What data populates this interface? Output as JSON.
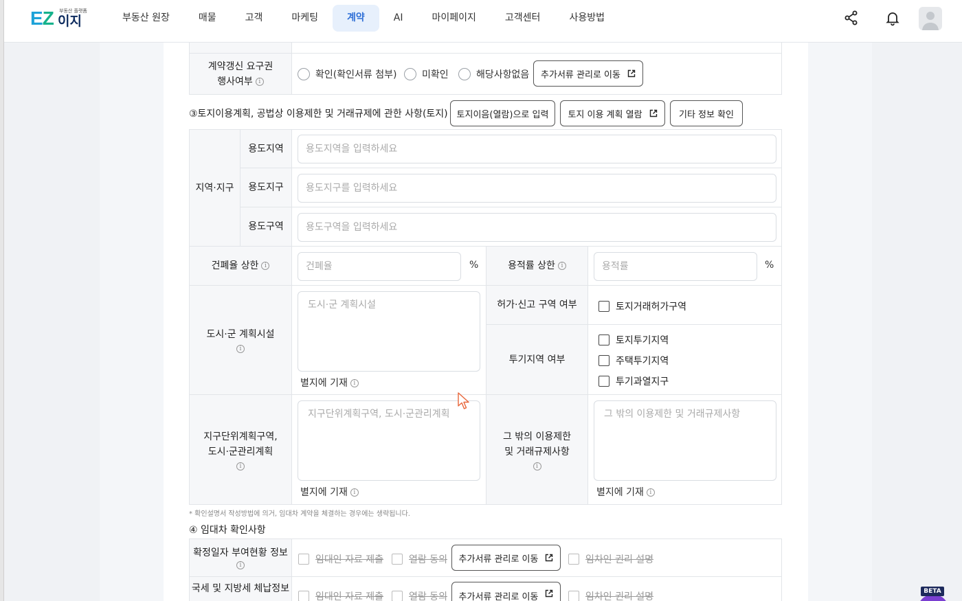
{
  "header": {
    "logo_text": "EZ",
    "logo_korean": "이지",
    "logo_tagline": "부동산 플랫폼",
    "nav": [
      {
        "label": "부동산 원장",
        "active": false
      },
      {
        "label": "매물",
        "active": false
      },
      {
        "label": "고객",
        "active": false
      },
      {
        "label": "마케팅",
        "active": false
      },
      {
        "label": "계약",
        "active": true
      },
      {
        "label": "AI",
        "active": false
      },
      {
        "label": "마이페이지",
        "active": false
      },
      {
        "label": "고객센터",
        "active": false
      },
      {
        "label": "사용방법",
        "active": false
      }
    ],
    "icons": [
      "share-icon",
      "bell-icon",
      "avatar"
    ],
    "accent_color": "#2f6fd6"
  },
  "renewal": {
    "label_line1": "계약갱신 요구권",
    "label_line2": "행사여부",
    "options": [
      "확인(확인서류 첨부)",
      "미확인",
      "해당사항없음"
    ],
    "button": "추가서류 관리로 이동"
  },
  "section3": {
    "title": "③토지이용계획, 공법상 이용제한 및 거래규제에 관한 사항(토지)",
    "buttons": [
      "토지이음(열람)으로 입력",
      "토지 이용 계획 열람",
      "기타 정보 확인"
    ],
    "zone_group_label": "지역·지구",
    "zones": [
      {
        "label": "용도지역",
        "placeholder": "용도지역을 입력하세요"
      },
      {
        "label": "용도지구",
        "placeholder": "용도지구를 입력하세요"
      },
      {
        "label": "용도구역",
        "placeholder": "용도구역을 입력하세요"
      }
    ],
    "coverage": {
      "label": "건폐율 상한",
      "placeholder": "건폐율",
      "unit": "%"
    },
    "far": {
      "label": "용적률 상한",
      "placeholder": "용적률",
      "unit": "%"
    },
    "city_plan": {
      "label": "도시·군 계획시설",
      "placeholder": "도시·군 계획시설",
      "attach": "별지에 기재"
    },
    "permit": {
      "label": "허가·신고 구역 여부",
      "option": "토지거래허가구역"
    },
    "speculation": {
      "label": "투기지역 여부",
      "options": [
        "토지투기지역",
        "주택투기지역",
        "투기과열지구"
      ]
    },
    "district_plan": {
      "label_line1": "지구단위계획구역,",
      "label_line2": "도시·군관리계획",
      "placeholder": "지구단위계획구역, 도시·군관리계획",
      "attach": "별지에 기재"
    },
    "other": {
      "label_line1": "그 밖의 이용제한",
      "label_line2": "및 거래규제사항",
      "placeholder": "그 밖의 이용제한 및 거래규제사항",
      "attach": "별지에 기재"
    },
    "note": "* 확인설명서 작성방법에 의거, 임대차 계약을 체결하는 경우에는 생략됩니다."
  },
  "section4": {
    "title": "④ 임대차 확인사항",
    "rows": [
      {
        "label": "확정일자 부여현황 정보",
        "options": [
          "임대인 자료 제출",
          "열람 동의"
        ],
        "button": "추가서류 관리로 이동",
        "extra": "임차인 권리 설명"
      },
      {
        "label": "국세 및 지방세 체납정보",
        "options": [
          "임대인 자료 제출",
          "열람 동의"
        ],
        "button": "추가서류 관리로 이동",
        "extra": "임차인 권리 설명"
      }
    ]
  },
  "badge": {
    "beta": "BETA"
  }
}
